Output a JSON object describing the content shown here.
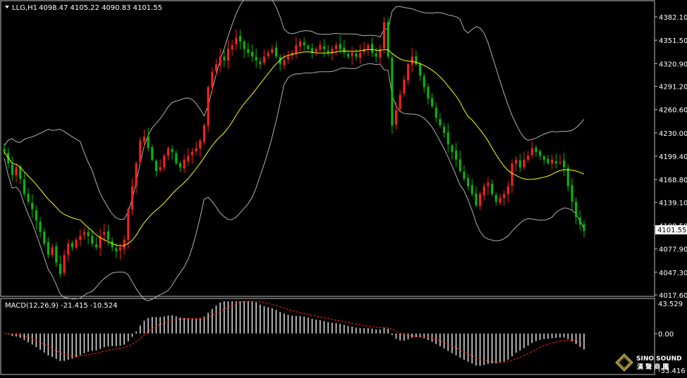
{
  "header": {
    "symbol": "LLG,H1",
    "ohlc": "4098.47 4105.22 4090.83 4101.55"
  },
  "macd": {
    "label": "MACD(12,26,9) -21.415 -10.524",
    "ticks": [
      "43.529",
      "0.00",
      "-53.416"
    ]
  },
  "logo": {
    "text_en": "SINO SOUND",
    "text_cn": "漢 聲 商 團"
  },
  "colors": {
    "bull": "#ff2020",
    "bear": "#00c000",
    "ma": "#ffff00",
    "bands": "#b0b0b0",
    "signal": "#ff2020",
    "hist": "#d8d8d8",
    "grid_frame": "#c0c0c0",
    "price_box": "#ffffff"
  },
  "chart_data": [
    {
      "type": "candlestick",
      "title": "LLG,H1",
      "ohlc_last": {
        "open": 4098.47,
        "high": 4105.22,
        "low": 4090.83,
        "close": 4101.55
      },
      "y_ticks": [
        "4382.10",
        "4351.50",
        "4320.90",
        "4291.20",
        "4260.60",
        "4230.00",
        "4199.40",
        "4168.80",
        "4139.10",
        "4108.50",
        "4077.90",
        "4047.30",
        "4017.60"
      ],
      "ylim": [
        4017.6,
        4382.1
      ],
      "current_price": "4101.55",
      "grid": false,
      "overlays": [
        "moving average (yellow)",
        "Bollinger Bands (grey)"
      ],
      "closes": [
        4205,
        4190,
        4175,
        4185,
        4170,
        4150,
        4140,
        4130,
        4115,
        4100,
        4085,
        4070,
        4080,
        4060,
        4045,
        4070,
        4085,
        4080,
        4090,
        4095,
        4100,
        4095,
        4085,
        4080,
        4095,
        4100,
        4090,
        4080,
        4075,
        4080,
        4090,
        4130,
        4160,
        4190,
        4220,
        4225,
        4210,
        4195,
        4180,
        4185,
        4200,
        4210,
        4205,
        4190,
        4185,
        4195,
        4200,
        4205,
        4210,
        4220,
        4240,
        4290,
        4310,
        4320,
        4330,
        4325,
        4340,
        4345,
        4355,
        4350,
        4340,
        4335,
        4330,
        4325,
        4320,
        4330,
        4335,
        4340,
        4330,
        4320,
        4325,
        4330,
        4335,
        4345,
        4350,
        4345,
        4340,
        4335,
        4340,
        4345,
        4340,
        4335,
        4340,
        4345,
        4340,
        4335,
        4330,
        4335,
        4330,
        4335,
        4340,
        4345,
        4335,
        4330,
        4340,
        4375,
        4330,
        4240,
        4260,
        4280,
        4300,
        4320,
        4330,
        4320,
        4305,
        4290,
        4275,
        4265,
        4250,
        4240,
        4230,
        4215,
        4205,
        4195,
        4180,
        4170,
        4160,
        4150,
        4135,
        4150,
        4160,
        4165,
        4150,
        4140,
        4145,
        4150,
        4160,
        4190,
        4195,
        4185,
        4195,
        4200,
        4210,
        4205,
        4200,
        4195,
        4190,
        4195,
        4190,
        4192,
        4185,
        4160,
        4140,
        4120,
        4110,
        4101.55
      ]
    },
    {
      "type": "macd",
      "title": "MACD(12,26,9)",
      "params": [
        12,
        26,
        9
      ],
      "macd": -21.415,
      "signal": -10.524,
      "y_ticks": [
        "43.529",
        "0.00",
        "-53.416"
      ],
      "ylim": [
        -53.416,
        43.529
      ]
    }
  ]
}
